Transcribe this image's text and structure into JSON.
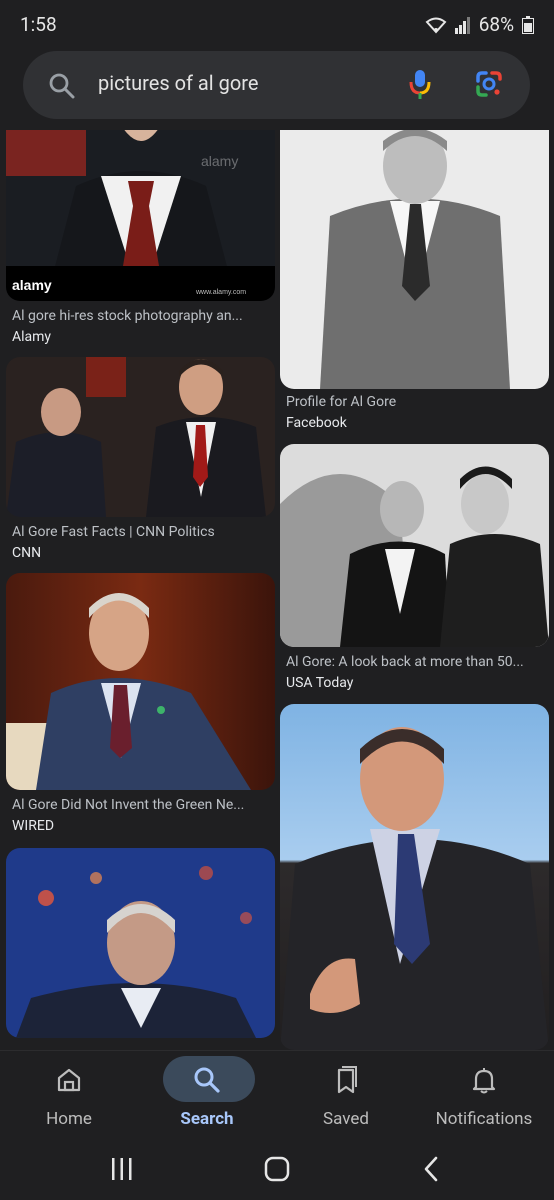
{
  "status": {
    "time": "1:58",
    "battery": "68%"
  },
  "search": {
    "query": "pictures of al gore"
  },
  "results": [
    {
      "title": "Al gore hi-res stock photography an...",
      "source": "Alamy",
      "image": "Al Gore in red tie, stock photo with watermark"
    },
    {
      "title": "Profile for Al Gore",
      "source": "Facebook",
      "image": "Black and white portrait of Al Gore"
    },
    {
      "title": "Al Gore Fast Facts | CNN Politics",
      "source": "CNN",
      "image": "Debate photo"
    },
    {
      "title": "Al Gore: A look back at more than 50...",
      "source": "USA Today",
      "image": "Black and white photo of two men"
    },
    {
      "title": "Al Gore Did Not Invent the Green Ne...",
      "source": "WIRED",
      "image": "Al Gore seated on stage"
    },
    {
      "title": "",
      "source": "",
      "image": "Al Gore speaking on stage"
    },
    {
      "title": "",
      "source": "",
      "image": "Al Gore with blue background"
    }
  ],
  "watermark": {
    "brand": "alamy",
    "site": "www.alamy.com"
  },
  "nav": {
    "home": "Home",
    "search": "Search",
    "saved": "Saved",
    "notifications": "Notifications"
  }
}
